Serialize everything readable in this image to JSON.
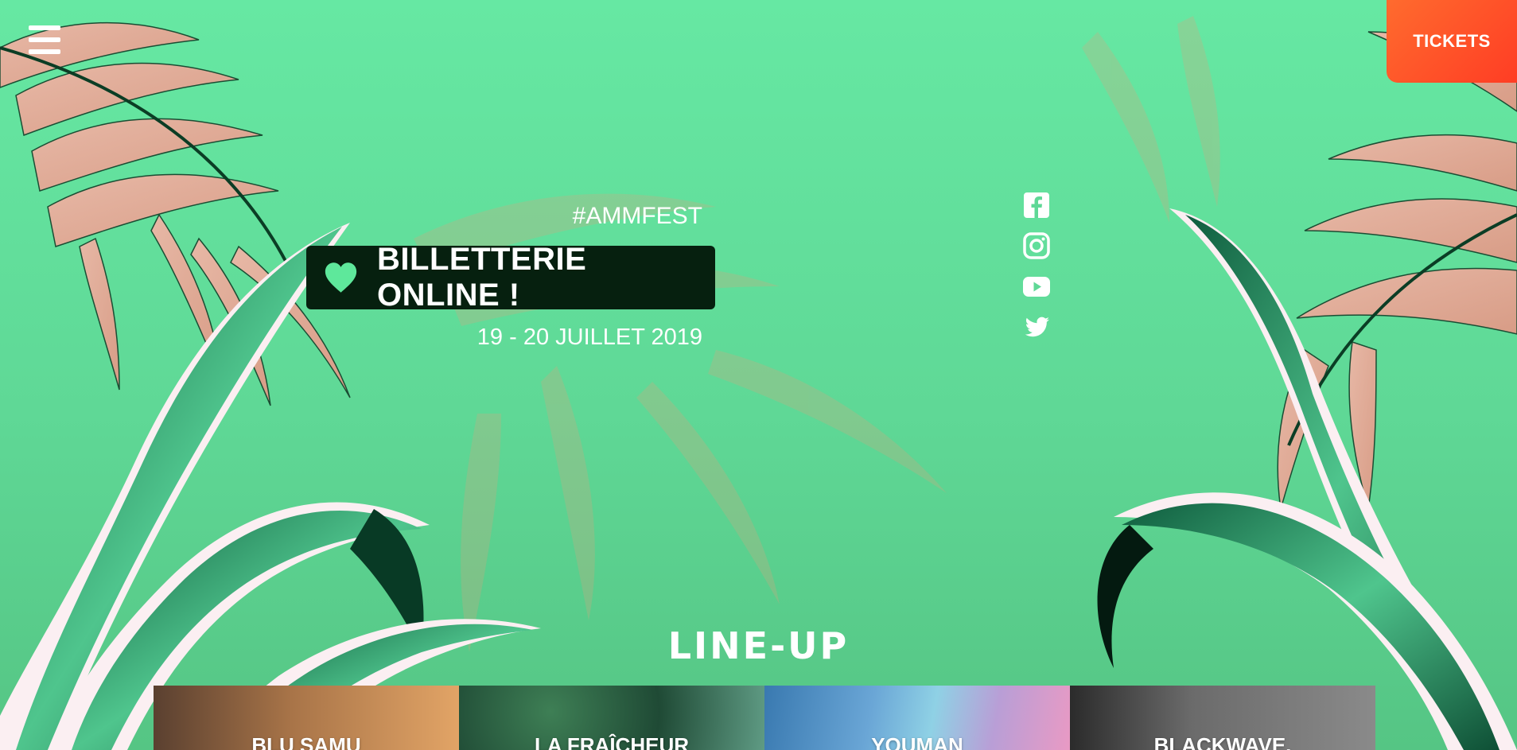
{
  "header": {
    "menu_icon": "hamburger-menu-icon",
    "tickets_label": "TICKETS"
  },
  "hero": {
    "hashtag": "#AMMFEST",
    "cta_label": "BILLETTERIE ONLINE !",
    "cta_icon": "heart-icon",
    "dates": "19 - 20 JUILLET 2019"
  },
  "socials": [
    {
      "icon": "facebook-icon"
    },
    {
      "icon": "instagram-icon"
    },
    {
      "icon": "youtube-icon"
    },
    {
      "icon": "twitter-icon"
    }
  ],
  "lineup": {
    "title": "LINE-UP",
    "artists": [
      {
        "name": "BLU SAMU"
      },
      {
        "name": "LA FRAÎCHEUR"
      },
      {
        "name": "YOUMAN"
      },
      {
        "name": "BLACKWAVE."
      }
    ]
  },
  "colors": {
    "background": "#66e8a3",
    "tickets_button": "#ff4f28",
    "cta_background": "#06200f",
    "heart": "#5ee89b",
    "leaf_pink": "#e5b7a4",
    "leaf_green": "#1f7a55"
  }
}
